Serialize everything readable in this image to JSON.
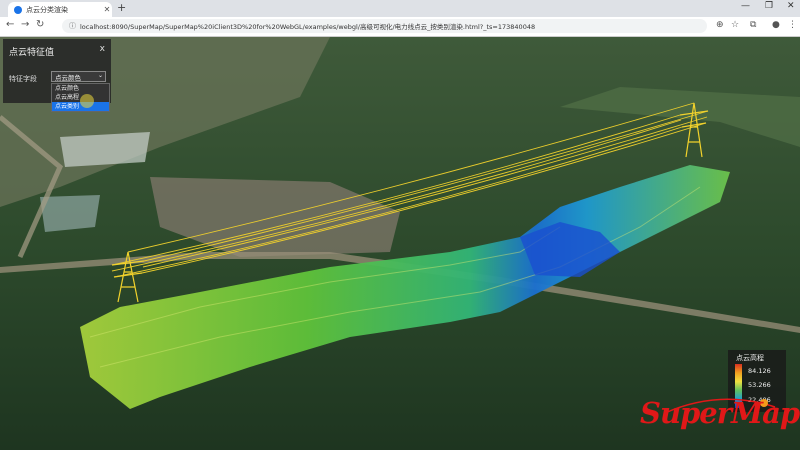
{
  "browser": {
    "tab_title": "点云分类渲染",
    "url": "localhost:8090/SuperMap/SuperMap%20iClient3D%20for%20WebGL/examples/webgl/高级可视化/电力线点云_按类别渲染.html?_ts=173840048",
    "colors": {
      "chrome": "#dee1e6",
      "accent": "#1a73e8"
    }
  },
  "panel": {
    "title": "点云特征值",
    "close": "x",
    "label": "特征字段",
    "select_value": "点云颜色",
    "options": [
      {
        "label": "点云颜色",
        "selected": false
      },
      {
        "label": "点云高程",
        "selected": false
      },
      {
        "label": "点云类别",
        "selected": true
      }
    ]
  },
  "legend": {
    "title": "点云高程",
    "values": [
      "84.126",
      "53.266",
      "22.406"
    ],
    "colors": [
      "#d83020",
      "#f0e040",
      "#20a0d0",
      "#2030c0"
    ]
  },
  "logo": {
    "text": "SuperMap",
    "color": "#e01818"
  }
}
